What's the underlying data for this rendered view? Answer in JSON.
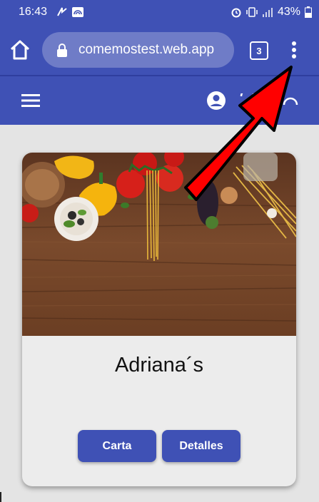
{
  "status_bar": {
    "time": "16:43",
    "battery_percent": "43%",
    "icons": [
      "nfc-icon",
      "cast-icon",
      "alarm-icon",
      "vibrate-icon",
      "signal-icon",
      "battery-icon"
    ]
  },
  "browser": {
    "url": "comemostest.web.app",
    "tab_count": "3",
    "icons": [
      "home-icon",
      "lock-icon",
      "more-vert-icon"
    ]
  },
  "toolbar": {
    "icons": [
      "menu-icon",
      "account-circle-icon"
    ]
  },
  "card": {
    "title": "Adriana´s",
    "buttons": {
      "carta": "Carta",
      "detalles": "Detalles"
    }
  },
  "colors": {
    "primary": "#3f51b5",
    "background": "#e4e4e4",
    "card": "#ececec",
    "annotation_arrow": "#ff0000"
  }
}
